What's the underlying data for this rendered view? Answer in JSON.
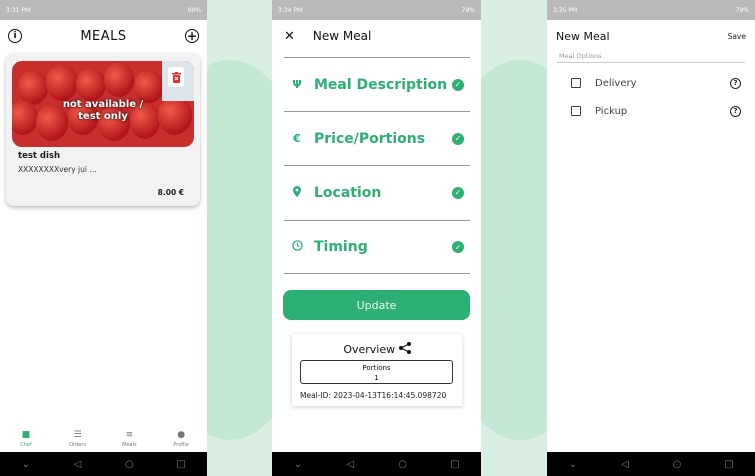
{
  "screen1": {
    "status_time": "3:31 PM",
    "status_right": "90%",
    "title": "MEALS",
    "card": {
      "image_overlay_line1": "not available /",
      "image_overlay_line2": "test only",
      "name": "test dish",
      "description": "XXXXXXXXvery jui ...",
      "price": "8.00 €"
    },
    "tabs": [
      {
        "label": "Chef",
        "icon": "chef-icon",
        "active": true
      },
      {
        "label": "Orders",
        "icon": "list-icon",
        "active": false
      },
      {
        "label": "Meals",
        "icon": "menu-icon",
        "active": false
      },
      {
        "label": "Profile",
        "icon": "person-icon",
        "active": false
      }
    ]
  },
  "screen2": {
    "status_time": "3:34 PM",
    "status_right": "79%",
    "title": "New Meal",
    "sections": [
      {
        "label": "Meal Description",
        "icon": "fork-knife-icon",
        "glyph": "🍴"
      },
      {
        "label": "Price/Portions",
        "icon": "euro-icon",
        "glyph": "€"
      },
      {
        "label": "Location",
        "icon": "pin-icon",
        "glyph": "⬤"
      },
      {
        "label": "Timing",
        "icon": "clock-icon",
        "glyph": "◷"
      }
    ],
    "update_label": "Update",
    "overview_title": "Overview",
    "portions_label": "Portions",
    "portions_value": "1",
    "meal_id": "Meal-ID: 2023-04-13T16:14:45.098720"
  },
  "screen3": {
    "status_time": "3:35 PM",
    "status_right": "79%",
    "title": "New Meal",
    "save_label": "Save",
    "options_header": "Meal Options",
    "options": [
      {
        "label": "Delivery",
        "checked": false
      },
      {
        "label": "Pickup",
        "checked": false
      }
    ]
  },
  "colors": {
    "accent": "#2eaf73",
    "background": "#d8efe1",
    "statusbar": "#b9b9b9"
  }
}
